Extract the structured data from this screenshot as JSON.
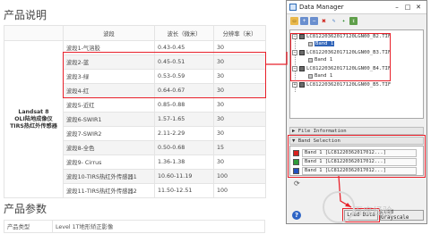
{
  "doc": {
    "section1_title": "产品说明",
    "section2_title": "产品参数",
    "table_headers": [
      "",
      "波段",
      "波长（微米）",
      "分辨率（米）"
    ],
    "satellite": "Landsat 8\nOLI陆地成像仪\nTIRS热红外传感器",
    "rows": [
      {
        "band": "波段1-气溶胶",
        "wavelength": "0.43-0.45",
        "resolution": "30"
      },
      {
        "band": "波段2-蓝",
        "wavelength": "0.45-0.51",
        "resolution": "30"
      },
      {
        "band": "波段3-绿",
        "wavelength": "0.53-0.59",
        "resolution": "30"
      },
      {
        "band": "波段4-红",
        "wavelength": "0.64-0.67",
        "resolution": "30"
      },
      {
        "band": "波段5-近红",
        "wavelength": "0.85-0.88",
        "resolution": "30"
      },
      {
        "band": "波段6-SWIR1",
        "wavelength": "1.57-1.65",
        "resolution": "30"
      },
      {
        "band": "波段7-SWIR2",
        "wavelength": "2.11-2.29",
        "resolution": "30"
      },
      {
        "band": "波段8-全色",
        "wavelength": "0.50-0.68",
        "resolution": "15"
      },
      {
        "band": "波段9- Cirrus",
        "wavelength": "1.36-1.38",
        "resolution": "30"
      },
      {
        "band": "波段10-TIRS热红外传感器1",
        "wavelength": "10.60-11.19",
        "resolution": "100"
      },
      {
        "band": "波段11-TIRS热红外传感器2",
        "wavelength": "11.50-12.51",
        "resolution": "100"
      }
    ],
    "param_label": "产品类型",
    "param_value": "Level 1T地形矫正影像"
  },
  "window": {
    "title": "Data Manager",
    "controls": {
      "minimize": "–",
      "maximize": "□",
      "close": "✕"
    },
    "toolbar_icons": [
      "open-icon",
      "expand-icon",
      "collapse-icon",
      "delete-icon",
      "edit-icon",
      "magic-icon",
      "add-icon"
    ],
    "files": [
      {
        "name": "LC81220362017120LGN00_B2.TIF",
        "band": "Band 1",
        "selected": true
      },
      {
        "name": "LC81220362017120LGN00_B3.TIF",
        "band": "Band 1",
        "selected": false
      },
      {
        "name": "LC81220362017120LGN00_B4.TIF",
        "band": "Band 1",
        "selected": false
      },
      {
        "name": "LC81220362017120LGN00_B5.TIF",
        "band": "",
        "selected": false
      }
    ],
    "file_information": "File Information",
    "band_selection": "Band Selection",
    "band_rows": [
      {
        "text": "Band 1 [LC81220362017012...]",
        "color": "#d8201c"
      },
      {
        "text": "Band 1 [LC81220362017012...]",
        "color": "#2e9b3a"
      },
      {
        "text": "Band 1 [LC81220362017012...]",
        "color": "#2150c0"
      }
    ],
    "load_data": "Load Data",
    "load_grayscale": "Load Grayscale"
  },
  "watermark": "百度经验",
  "colors": {
    "highlight": "#e8202a",
    "selection": "#2f63b8"
  }
}
